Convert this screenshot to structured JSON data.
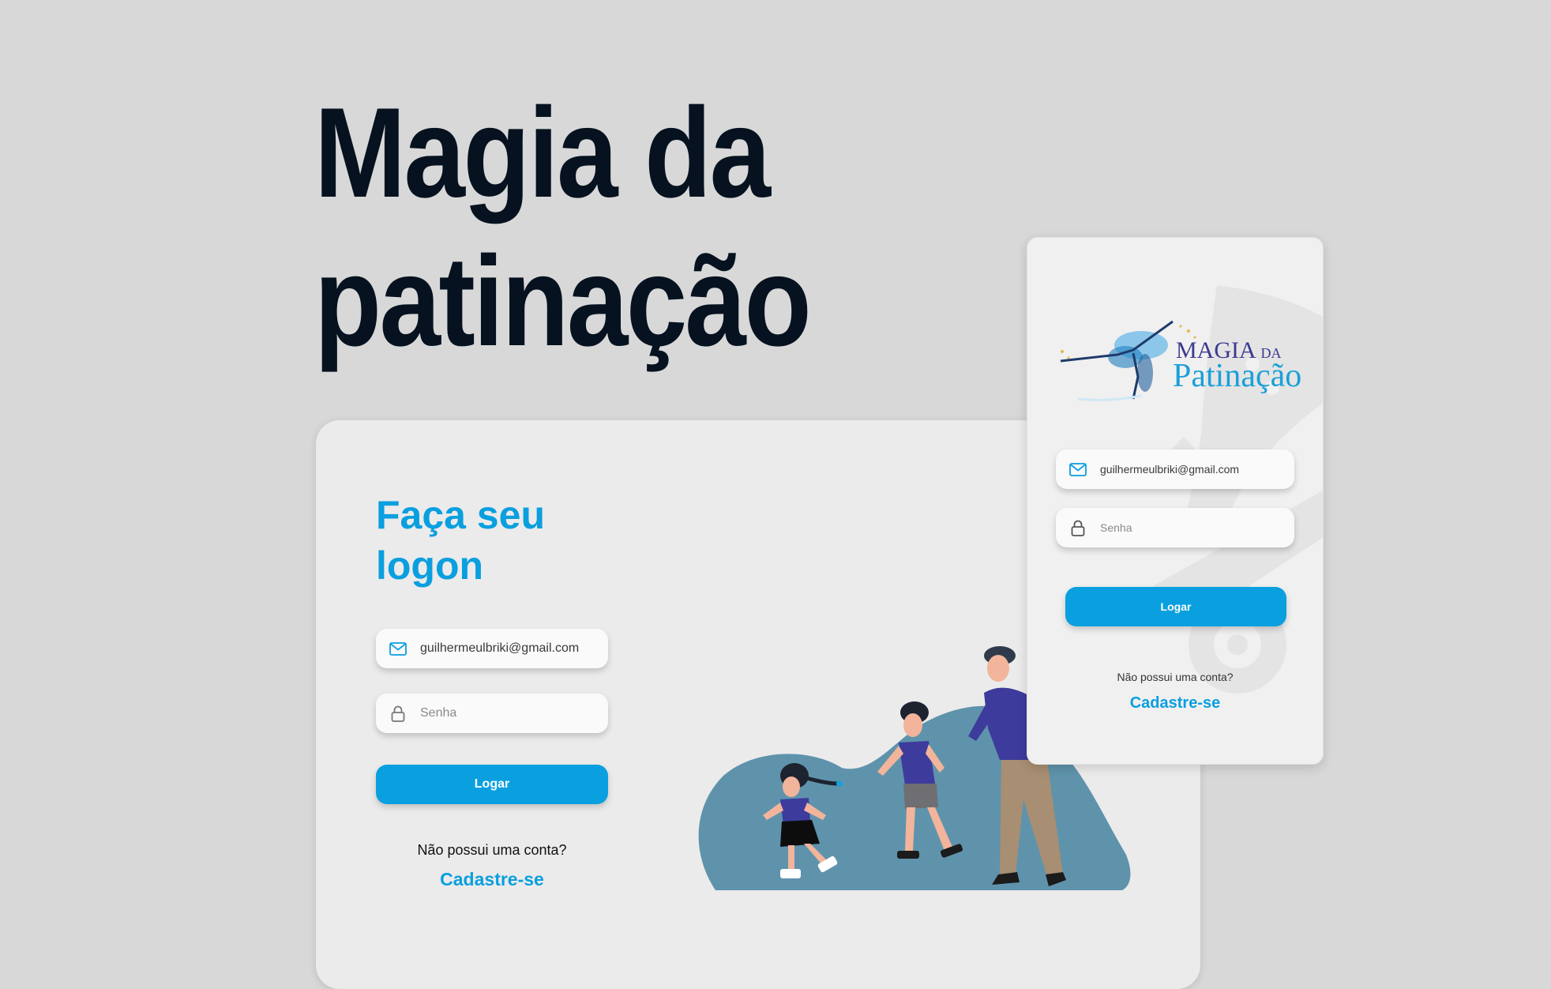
{
  "hero": {
    "title_line1": "Magia da",
    "title_line2": "patinação"
  },
  "desktop_login": {
    "heading_line1": "Faça seu",
    "heading_line2": "logon",
    "email": {
      "value": "guilhermeulbriki@gmail.com",
      "icon": "mail-icon"
    },
    "password": {
      "placeholder": "Senha",
      "icon": "lock-icon"
    },
    "submit_label": "Logar",
    "no_account_text": "Não possui uma conta?",
    "signup_link": "Cadastre-se"
  },
  "mobile_login": {
    "logo": {
      "line1_main": "MAGIA",
      "line1_small": "DA",
      "line2": "Patinação"
    },
    "email": {
      "value": "guilhermeulbriki@gmail.com",
      "icon": "mail-icon"
    },
    "password": {
      "placeholder": "Senha",
      "icon": "lock-icon"
    },
    "submit_label": "Logar",
    "no_account_text": "Não possui uma conta?",
    "signup_link": "Cadastre-se"
  },
  "colors": {
    "background": "#d8d8d8",
    "accent": "#0aa0e0",
    "title": "#06121f",
    "card": "#ebebeb",
    "illustration_blob": "#5f93ac",
    "shirt": "#3d3b9c"
  }
}
